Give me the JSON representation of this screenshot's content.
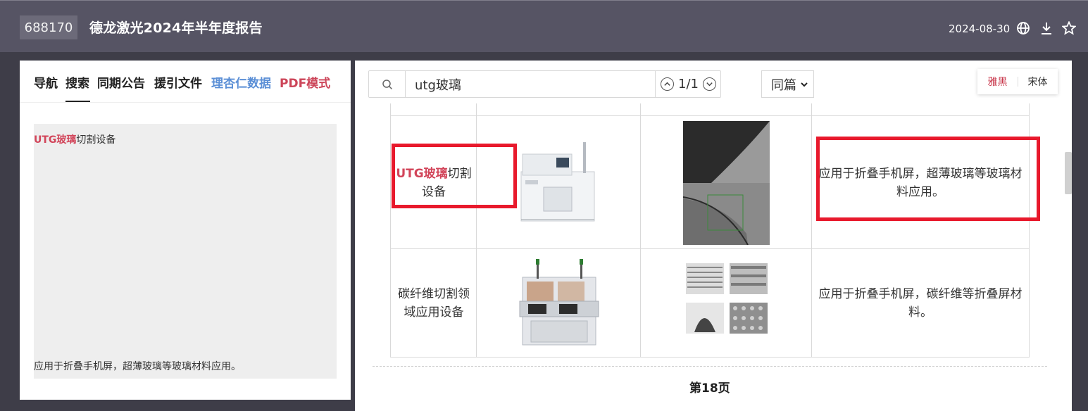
{
  "header": {
    "stock_code": "688170",
    "title": "德龙激光2024年半年度报告",
    "date": "2024-08-30",
    "icons": [
      "globe-icon",
      "download-icon",
      "star-icon"
    ]
  },
  "left_panel": {
    "tabs": [
      {
        "label": "导航",
        "color": "#222222"
      },
      {
        "label": "搜索",
        "color": "#222222",
        "active": true
      },
      {
        "label": "同期公告",
        "color": "#222222"
      },
      {
        "label": "援引文件",
        "color": "#222222"
      },
      {
        "label": "理杏仁数据",
        "color": "#5b8fd6"
      },
      {
        "label": "PDF模式",
        "color": "#cc4559"
      }
    ],
    "result": {
      "title_highlight": "UTG玻璃",
      "title_rest": "切割设备",
      "description": "应用于折叠手机屏，超薄玻璃等玻璃材料应用。"
    }
  },
  "search": {
    "query": "utg玻璃",
    "match_count": "1/1",
    "scope": "同篇"
  },
  "font_switch": {
    "options": [
      "雅黑",
      "宋体"
    ],
    "active": "雅黑",
    "active_color": "#c8354a"
  },
  "document": {
    "rows": [
      {
        "name_highlight": "UTG玻璃",
        "name_rest": "切割",
        "name_line2": "设备",
        "description": "应用于折叠手机屏，超薄玻璃等玻璃材料应用。"
      },
      {
        "name_line1": "碳纤维切割领",
        "name_line2": "域应用设备",
        "description": "应用于折叠手机屏，碳纤维等折叠屏材料。"
      }
    ],
    "page_label": "第18页"
  }
}
